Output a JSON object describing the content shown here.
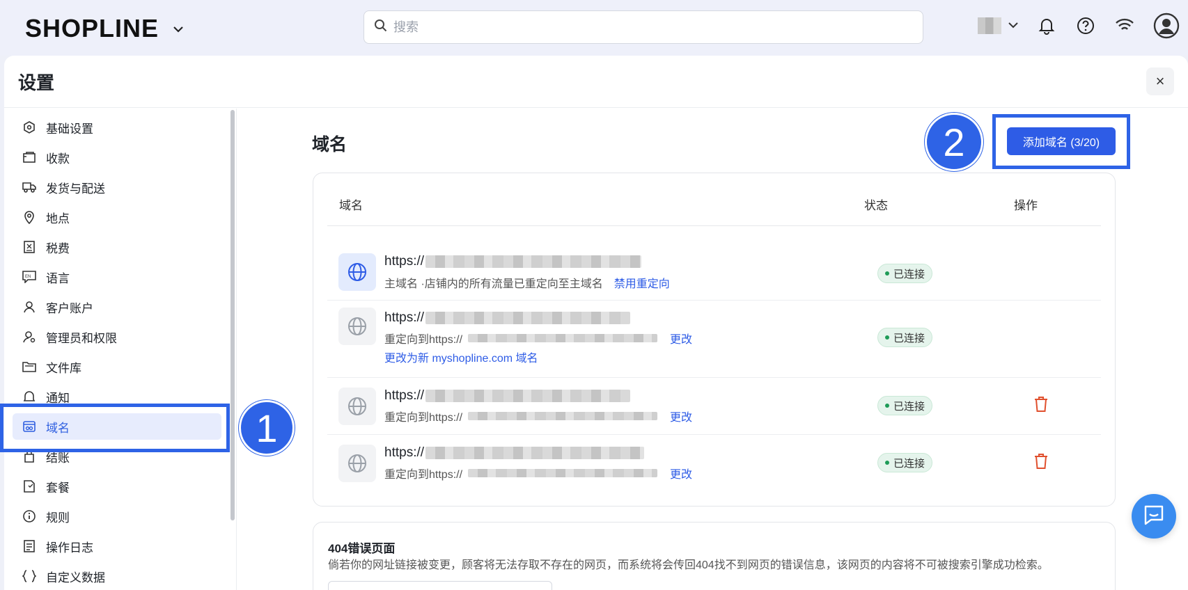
{
  "topbar": {
    "brand": "SHOPLINE",
    "search_placeholder": "搜索"
  },
  "panel": {
    "title": "设置",
    "close_icon": "×"
  },
  "sidebar": {
    "items": [
      {
        "label": "基础设置",
        "icon": "hexagon-settings-icon"
      },
      {
        "label": "收款",
        "icon": "wallet-icon"
      },
      {
        "label": "发货与配送",
        "icon": "truck-icon"
      },
      {
        "label": "地点",
        "icon": "location-pin-icon"
      },
      {
        "label": "税费",
        "icon": "tax-receipt-icon"
      },
      {
        "label": "语言",
        "icon": "language-icon"
      },
      {
        "label": "客户账户",
        "icon": "user-icon"
      },
      {
        "label": "管理员和权限",
        "icon": "admin-user-icon"
      },
      {
        "label": "文件库",
        "icon": "folder-icon"
      },
      {
        "label": "通知",
        "icon": "bell-icon"
      },
      {
        "label": "域名",
        "icon": "domain-icon",
        "active": true
      },
      {
        "label": "结账",
        "icon": "bag-icon"
      },
      {
        "label": "套餐",
        "icon": "plan-icon"
      },
      {
        "label": "规则",
        "icon": "info-icon"
      },
      {
        "label": "操作日志",
        "icon": "log-icon"
      },
      {
        "label": "自定义数据",
        "icon": "custom-data-icon"
      }
    ]
  },
  "annotations": {
    "badge1": "1",
    "badge2": "2"
  },
  "main": {
    "title": "域名",
    "add_button": "添加域名 (3/20)",
    "table": {
      "headers": {
        "domain": "域名",
        "status": "状态",
        "action": "操作"
      },
      "rows": [
        {
          "url_prefix": "https://",
          "sub_text": "主域名 ·店铺内的所有流量已重定向至主域名",
          "sub_link": "禁用重定向",
          "status": "已连接",
          "primary": true
        },
        {
          "url_prefix": "https://",
          "sub_text": "重定向到https://",
          "sub_link": "更改",
          "extra_link": "更改为新 myshopline.com 域名",
          "status": "已连接"
        },
        {
          "url_prefix": "https://",
          "sub_text": "重定向到https://",
          "sub_link": "更改",
          "status": "已连接",
          "deletable": true
        },
        {
          "url_prefix": "https://",
          "sub_text": "重定向到https://",
          "sub_link": "更改",
          "status": "已连接",
          "deletable": true
        }
      ]
    },
    "error_page": {
      "title": "404错误页面",
      "description": "倘若你的网址链接被变更，顾客将无法存取不存在的网页，而系统将会传回404找不到网页的错误信息，该网页的内容将不可被搜索引擎成功检索。"
    }
  },
  "colors": {
    "accent": "#2e5ce6",
    "annotation": "#2e63e6",
    "status_bg": "#e5f4ec",
    "danger": "#e0502e"
  }
}
